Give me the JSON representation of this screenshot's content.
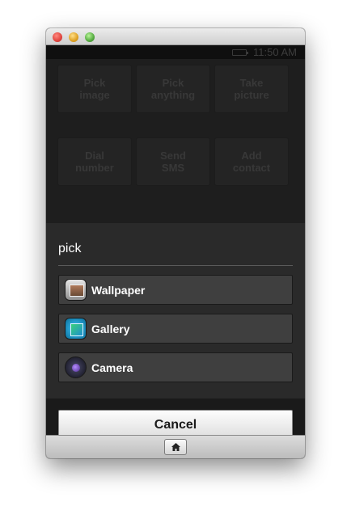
{
  "statusbar": {
    "time": "11:50 AM"
  },
  "background_tiles": [
    "Pick\nimage",
    "Pick\nanything",
    "Take\npicture",
    "Dial\nnumber",
    "Send\nSMS",
    "Add\ncontact"
  ],
  "dialog": {
    "title": "pick",
    "items": [
      {
        "label": "Wallpaper",
        "icon": "wallpaper-icon"
      },
      {
        "label": "Gallery",
        "icon": "gallery-icon"
      },
      {
        "label": "Camera",
        "icon": "camera-icon"
      }
    ],
    "cancel_label": "Cancel"
  },
  "colors": {
    "dialog_bg": "#2a2a2a",
    "item_bg": "#3f3f3f"
  }
}
